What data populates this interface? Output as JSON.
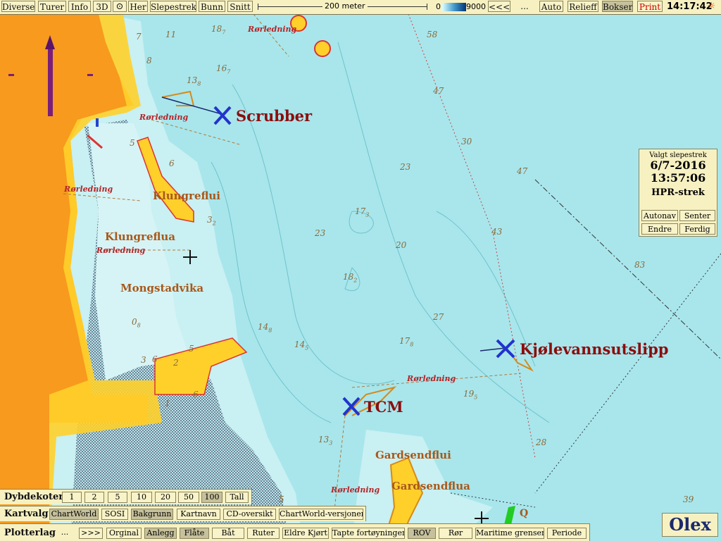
{
  "toolbar": {
    "left": [
      "Diverse",
      "Turer",
      "Info",
      "3D",
      "",
      "Her",
      "Slepestrek",
      "Bunn",
      "Snitt"
    ],
    "scale_label": "200 meter",
    "depth_min": "0",
    "depth_max": "9000",
    "back": "<<<",
    "dots": "...",
    "auto": "Auto",
    "relief": "Relieff",
    "bokser": "Bokser",
    "print": "Print",
    "time": "14:17:42"
  },
  "panel": {
    "title": "Valgt slepestrek",
    "date": "6/7-2016",
    "time": "13:57:06",
    "strek": "HPR-strek",
    "buttons": [
      "Autonav",
      "Senter",
      "Endre",
      "Ferdig"
    ]
  },
  "markers": {
    "scrubber": "Scrubber",
    "kjolevann": "Kjølevannsutslipp",
    "tcm": "TCM"
  },
  "places": {
    "klungreflui": "Klungreflui",
    "klungreflua": "Klungreflua",
    "mongstadvika": "Mongstadvika",
    "gardsendflui": "Gardsendflui",
    "gardsendflua": "Gardsendflua",
    "pipe": "Rørledning",
    "q": "Q"
  },
  "soundings": [
    "58",
    "47",
    "30",
    "47",
    "23",
    "23",
    "20",
    "43",
    "83",
    "27",
    "28",
    "39",
    "11",
    "7",
    "8",
    "1",
    "3",
    "2",
    "5",
    "6",
    "5",
    "6",
    "6",
    "5"
  ],
  "soundings_sub": [
    {
      "main": "18",
      "sub": "7"
    },
    {
      "main": "16",
      "sub": "7"
    },
    {
      "main": "13",
      "sub": "8"
    },
    {
      "main": "17",
      "sub": "3"
    },
    {
      "main": "18",
      "sub": "2"
    },
    {
      "main": "14",
      "sub": "8"
    },
    {
      "main": "14",
      "sub": "5"
    },
    {
      "main": "17",
      "sub": "8"
    },
    {
      "main": "19",
      "sub": "5"
    },
    {
      "main": "13",
      "sub": "3"
    },
    {
      "main": "0",
      "sub": "8"
    },
    {
      "main": "3",
      "sub": "2"
    }
  ],
  "bottom": {
    "dybde_label": "Dybdekoter",
    "dybde": [
      "1",
      "2",
      "5",
      "10",
      "20",
      "50",
      "100",
      "Tall"
    ],
    "dybde_on": "100",
    "kart_label": "Kartvalg",
    "kart": [
      "ChartWorld",
      "SOSI",
      "Bakgrunn",
      "Kartnavn",
      "CD-oversikt",
      "ChartWorld-versjoner"
    ],
    "plot_label": "Plotterlag",
    "plot": [
      "...",
      ">>>",
      "Orginal",
      "Anlegg",
      "Flåte",
      "Båt",
      "Ruter",
      "Eldre Kjørt",
      "Tapte fortøyninger",
      "ROV",
      "Rør",
      "Maritime grenser",
      "Periode"
    ],
    "logo": "Olex"
  }
}
